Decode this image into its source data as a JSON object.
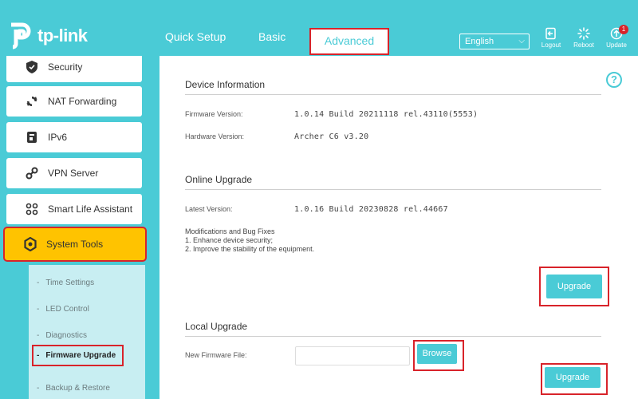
{
  "header": {
    "brand": "tp-link",
    "tabs": [
      {
        "label": "Quick Setup"
      },
      {
        "label": "Basic"
      },
      {
        "label": "Advanced"
      }
    ],
    "language": "English",
    "actions": {
      "logout": "Logout",
      "reboot": "Reboot",
      "update": "Update",
      "update_badge": "1"
    }
  },
  "sidebar": {
    "items": [
      {
        "label": "Security",
        "icon": "shield-icon"
      },
      {
        "label": "NAT Forwarding",
        "icon": "nat-icon"
      },
      {
        "label": "IPv6",
        "icon": "ipv6-icon"
      },
      {
        "label": "VPN Server",
        "icon": "vpn-icon"
      },
      {
        "label": "Smart Life Assistant",
        "icon": "smart-life-icon"
      },
      {
        "label": "System Tools",
        "icon": "gear-icon"
      }
    ],
    "submenu": [
      {
        "label": "Time Settings"
      },
      {
        "label": "LED Control"
      },
      {
        "label": "Diagnostics"
      },
      {
        "label": "Firmware Upgrade"
      },
      {
        "label": "Backup & Restore"
      }
    ]
  },
  "main": {
    "device_info": {
      "title": "Device Information",
      "firmware_label": "Firmware Version:",
      "firmware_value": "1.0.14 Build 20211118 rel.43110(5553)",
      "hardware_label": "Hardware Version:",
      "hardware_value": "Archer C6 v3.20"
    },
    "online_upgrade": {
      "title": "Online Upgrade",
      "latest_label": "Latest Version:",
      "latest_value": "1.0.16 Build 20230828 rel.44667",
      "notes_title": "Modifications and Bug Fixes",
      "notes": [
        "1. Enhance device security;",
        "2. Improve the stability of the equipment."
      ],
      "upgrade_button": "Upgrade"
    },
    "local_upgrade": {
      "title": "Local Upgrade",
      "file_label": "New Firmware File:",
      "file_value": "",
      "browse_button": "Browse",
      "upgrade_button": "Upgrade"
    }
  },
  "colors": {
    "brand": "#4acbd6",
    "active_menu": "#ffc300",
    "highlight": "#d8232a"
  }
}
